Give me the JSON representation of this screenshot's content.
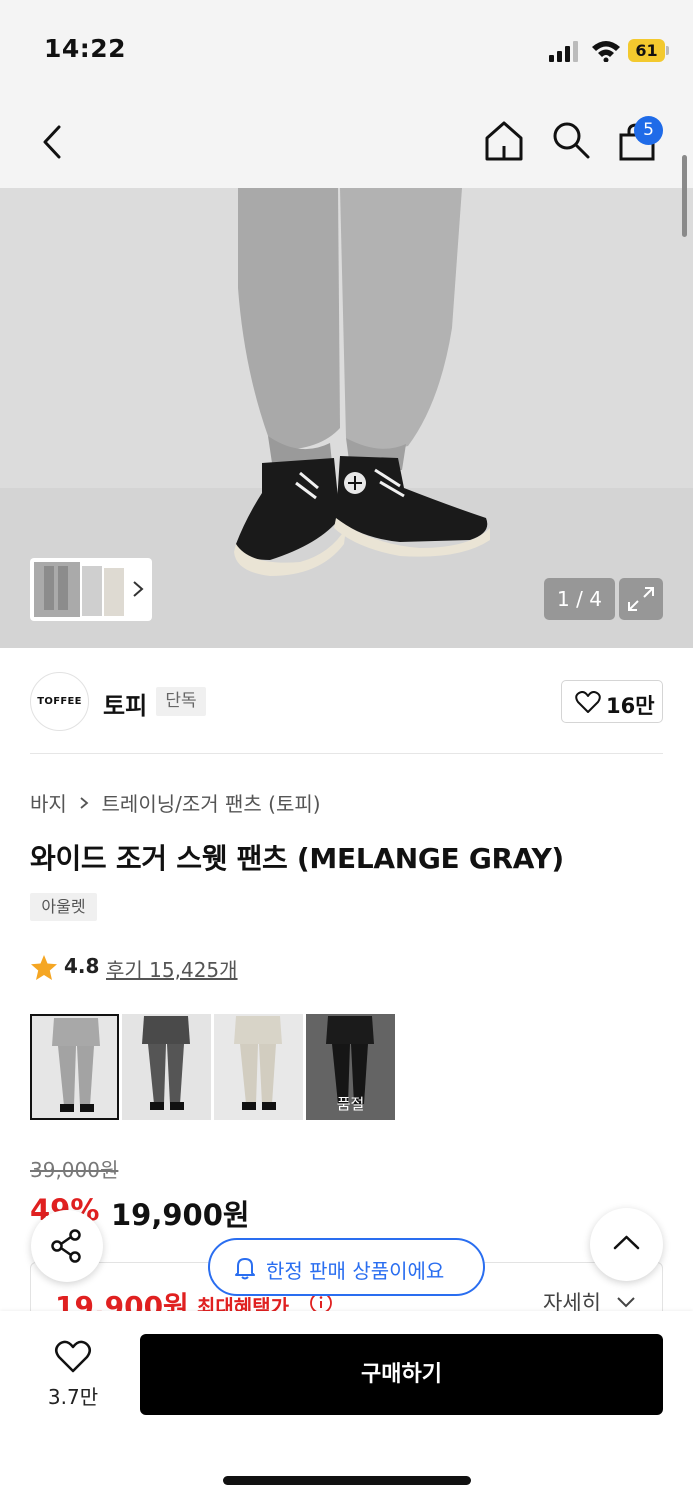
{
  "status_bar": {
    "time": "14:22",
    "battery": "61",
    "icons": [
      "signal-icon",
      "wifi-icon",
      "battery-icon"
    ]
  },
  "nav": {
    "back_icon": "back-chevron-icon",
    "home_icon": "home-icon",
    "search_icon": "search-icon",
    "cart_icon": "shopping-bag-icon",
    "cart_count": "5"
  },
  "gallery": {
    "counter": "1 / 4",
    "expand_icon": "expand-icon"
  },
  "brand": {
    "logo_text": "TOFFEE",
    "name": "토피",
    "tag": "단독",
    "like_count": "16만"
  },
  "breadcrumb": {
    "category": "바지",
    "subcategory": "트레이닝/조거 팬츠 (토피)"
  },
  "product": {
    "title": "와이드 조거 스웻 팬츠 (MELANGE GRAY)",
    "outlet_tag": "아울렛",
    "rating": "4.8",
    "reviews": "후기 15,425개"
  },
  "colors": [
    {
      "name": "melange-gray",
      "selected": true,
      "soldout": ""
    },
    {
      "name": "charcoal",
      "selected": false,
      "soldout": ""
    },
    {
      "name": "ivory",
      "selected": false,
      "soldout": ""
    },
    {
      "name": "black",
      "selected": false,
      "soldout": "품절"
    }
  ],
  "price": {
    "original": "39,000원",
    "discount": "49%",
    "sale": "19,900원"
  },
  "benefit": {
    "price": "19,900원",
    "label": "최대혜택가",
    "details": "자세히"
  },
  "toast": {
    "text": "한정 판매 상품이에요"
  },
  "bottom": {
    "wish_count": "3.7만",
    "buy_label": "구매하기"
  },
  "theme": {
    "accent_blue": "#2a6ef0",
    "sale_red": "#e02020",
    "badge_blue": "#1f6be8",
    "battery_yellow": "#f3c92e"
  }
}
